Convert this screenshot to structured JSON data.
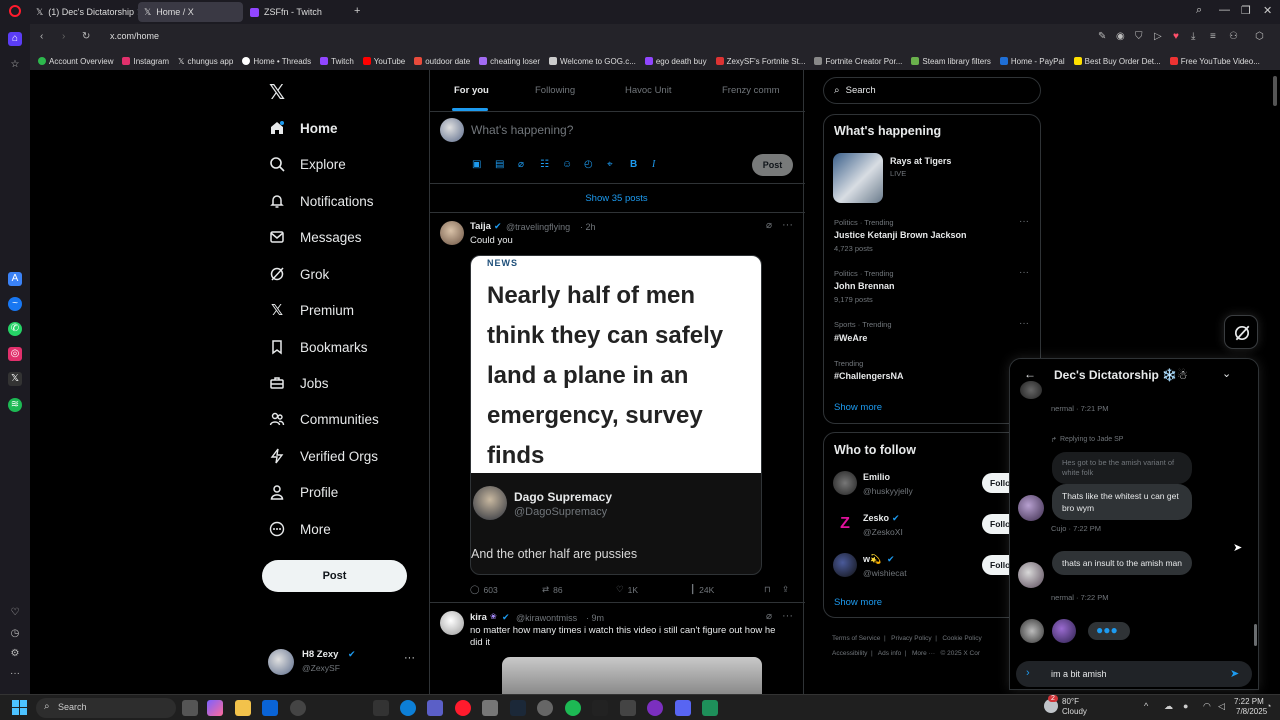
{
  "browser": {
    "tabs": [
      {
        "label": "(1) Dec's Dictatorship ❄️ ☃",
        "active": false
      },
      {
        "label": "Home / X",
        "active": true
      },
      {
        "label": "ZSFfn - Twitch",
        "active": false
      }
    ],
    "url": "x.com/home",
    "bookmarks": [
      "Account Overview",
      "Instagram",
      "chungus app",
      "Home • Threads",
      "Twitch",
      "YouTube",
      "outdoor date",
      "cheating loser",
      "Welcome to GOG.c...",
      "ego death buy",
      "ZexySF's Fortnite St...",
      "Fortnite Creator Por...",
      "Steam library filters",
      "Home - PayPal",
      "Best Buy Order Det...",
      "Free YouTube Video..."
    ]
  },
  "nav": {
    "items": [
      {
        "label": "Home",
        "icon": "home-icon"
      },
      {
        "label": "Explore",
        "icon": "search-icon"
      },
      {
        "label": "Notifications",
        "icon": "bell-icon"
      },
      {
        "label": "Messages",
        "icon": "envelope-icon"
      },
      {
        "label": "Grok",
        "icon": "grok-icon"
      },
      {
        "label": "Premium",
        "icon": "x-logo-icon"
      },
      {
        "label": "Bookmarks",
        "icon": "bookmark-icon"
      },
      {
        "label": "Jobs",
        "icon": "briefcase-icon"
      },
      {
        "label": "Communities",
        "icon": "people-icon"
      },
      {
        "label": "Verified Orgs",
        "icon": "lightning-icon"
      },
      {
        "label": "Profile",
        "icon": "person-icon"
      },
      {
        "label": "More",
        "icon": "more-circle-icon"
      }
    ],
    "post_label": "Post",
    "account": {
      "name": "H8 Zexy",
      "handle": "@ZexySF"
    }
  },
  "feed": {
    "tabs": [
      "For you",
      "Following",
      "Havoc Unit",
      "Frenzy comm"
    ],
    "compose_placeholder": "What's happening?",
    "compose_post_label": "Post",
    "show_posts": "Show 35 posts",
    "post1": {
      "name": "Taija",
      "handle": "@travelingflying",
      "time": "· 2h",
      "text": "Could you",
      "image_label": "NEWS",
      "image_headline": "Nearly half of men think they can safely land a plane in an emergency, survey finds",
      "quote_name": "Dago Supremacy",
      "quote_handle": "@DagoSupremacy",
      "quote_text": "And the other half are pussies",
      "replies": "603",
      "reposts": "86",
      "likes": "1K",
      "views": "24K"
    },
    "post2": {
      "name": "kira",
      "handle": "@kirawontmiss",
      "time": "· 9m",
      "text": "no matter how many times i watch this video i still can't figure out how he did it"
    }
  },
  "sidebar": {
    "search_placeholder": "Search",
    "whats_happening": {
      "title": "What's happening",
      "live": {
        "title": "Rays at Tigers",
        "status": "LIVE"
      },
      "trends": [
        {
          "category": "Politics · Trending",
          "name": "Justice Ketanji Brown Jackson",
          "count": "4,723 posts"
        },
        {
          "category": "Politics · Trending",
          "name": "John Brennan",
          "count": "9,179 posts"
        },
        {
          "category": "Sports · Trending",
          "name": "#WeAre",
          "count": ""
        },
        {
          "category": "Trending",
          "name": "#ChallengersNA",
          "count": ""
        }
      ],
      "show_more": "Show more"
    },
    "who_to_follow": {
      "title": "Who to follow",
      "users": [
        {
          "name": "Emilio",
          "handle": "@huskyyjelly",
          "follow": "Follow"
        },
        {
          "name": "Zesko",
          "handle": "@ZeskoXI",
          "follow": "Follow"
        },
        {
          "name": "w💫",
          "handle": "@wishiecat",
          "follow": "Follow"
        }
      ],
      "show_more": "Show more"
    },
    "footer": [
      "Terms of Service",
      "Privacy Policy",
      "Cookie Policy",
      "Accessibility",
      "Ads info",
      "More ···",
      "© 2025 X Cor"
    ]
  },
  "chat": {
    "title": "Dec's Dictatorship ❄️☃",
    "msg_top_meta": "nermal · 7:21 PM",
    "replying_to": "Replying to Jade SP",
    "quoted": "Hes got to be the amish variant of white folk",
    "msg1": "Thats like the whitest u can get bro wym",
    "msg1_meta": "Cujo · 7:22 PM",
    "msg2": "thats an insult to the amish man",
    "msg2_meta": "nermal · 7:22 PM",
    "input_value": "im a bit amish"
  },
  "taskbar": {
    "search": "Search",
    "weather_temp": "80°F",
    "weather_desc": "Cloudy",
    "time": "7:22 PM",
    "date": "7/8/2025",
    "notif_count": "2"
  },
  "colors": {
    "accent": "#1d9bf0",
    "bg": "#000000",
    "border": "#2f3336",
    "muted": "#71767b"
  }
}
